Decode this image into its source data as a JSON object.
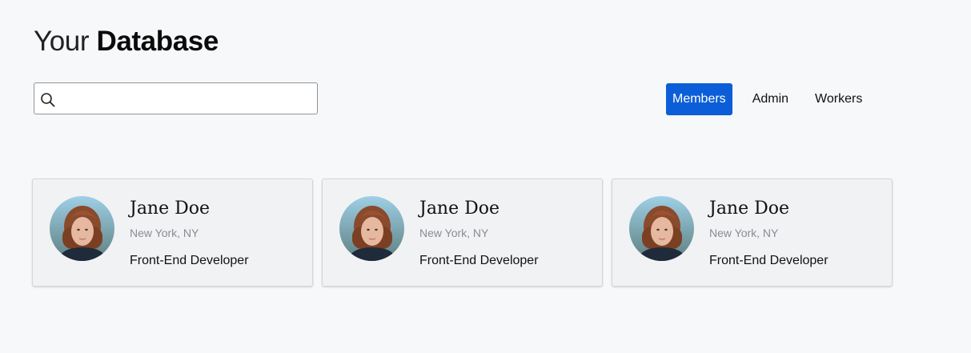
{
  "header": {
    "title_prefix": "Your",
    "title_main": "Database"
  },
  "search": {
    "placeholder": "",
    "value": "",
    "icon": "search-icon"
  },
  "tabs": [
    {
      "label": "Members",
      "active": true
    },
    {
      "label": "Admin",
      "active": false
    },
    {
      "label": "Workers",
      "active": false
    }
  ],
  "cards": [
    {
      "name": "Jane Doe",
      "location": "New York, NY",
      "role": "Front-End Developer",
      "avatar": "avatar-photo"
    },
    {
      "name": "Jane Doe",
      "location": "New York, NY",
      "role": "Front-End Developer",
      "avatar": "avatar-photo"
    },
    {
      "name": "Jane Doe",
      "location": "New York, NY",
      "role": "Front-End Developer",
      "avatar": "avatar-photo"
    }
  ],
  "colors": {
    "accent": "#0b5ed7",
    "background": "#f7f8fa",
    "card_background": "#f1f2f4",
    "muted_text": "#888c93"
  }
}
